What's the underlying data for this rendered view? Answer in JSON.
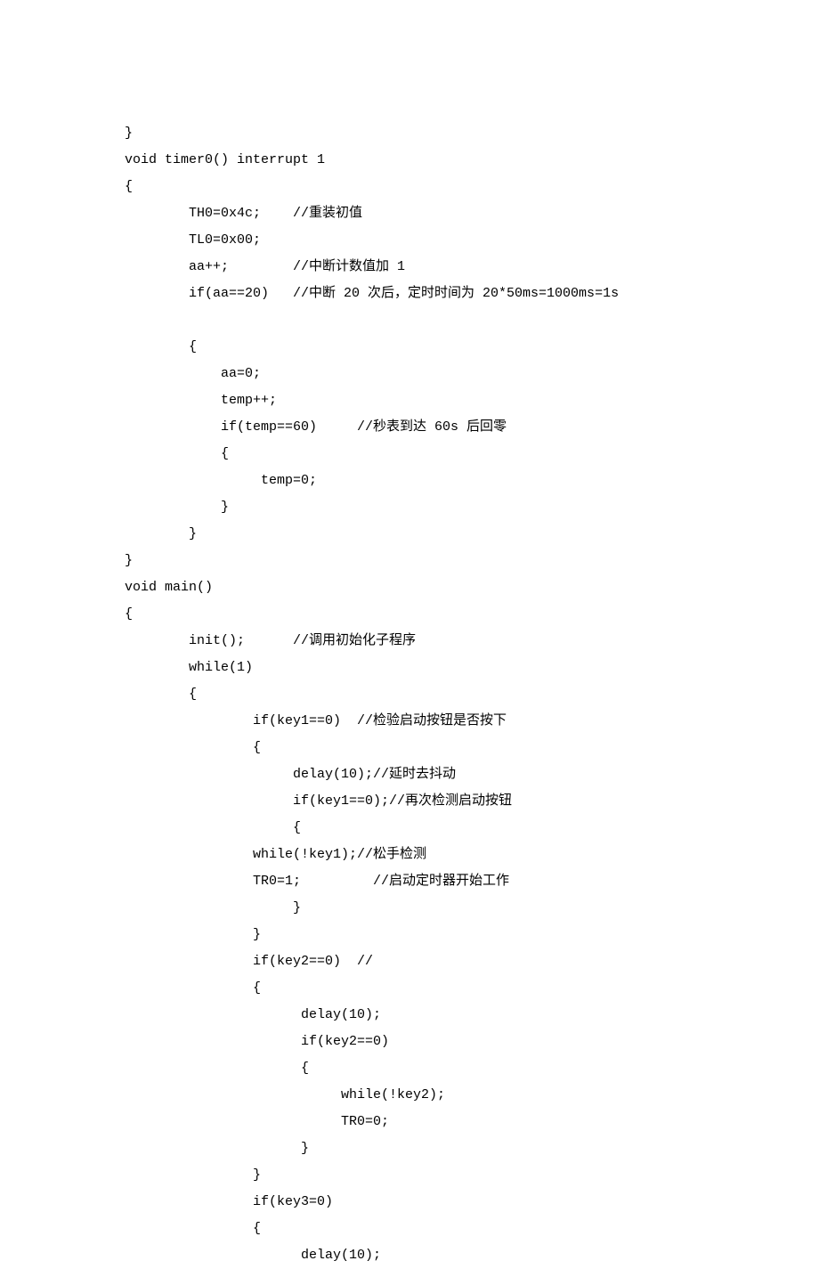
{
  "code": {
    "lines": [
      "}",
      "void timer0() interrupt 1",
      "{",
      "        TH0=0x4c;    //重装初值",
      "        TL0=0x00;",
      "        aa++;        //中断计数值加 1",
      "        if(aa==20)   //中断 20 次后，定时时间为 20*50ms=1000ms=1s",
      "",
      "        {",
      "            aa=0;",
      "            temp++;",
      "            if(temp==60)     //秒表到达 60s 后回零",
      "            {",
      "                 temp=0;",
      "            }",
      "        }",
      "}",
      "void main()",
      "{",
      "        init();      //调用初始化子程序",
      "        while(1)",
      "        {",
      "                if(key1==0)  //检验启动按钮是否按下",
      "                {",
      "                     delay(10);//延时去抖动",
      "                     if(key1==0);//再次检测启动按钮",
      "                     {",
      "                while(!key1);//松手检测",
      "                TR0=1;         //启动定时器开始工作",
      "                     }",
      "                }",
      "                if(key2==0)  //",
      "                {",
      "                      delay(10);",
      "                      if(key2==0)",
      "                      {",
      "                           while(!key2);",
      "                           TR0=0;",
      "                      }",
      "                }",
      "                if(key3=0)",
      "                {",
      "                      delay(10);"
    ]
  }
}
